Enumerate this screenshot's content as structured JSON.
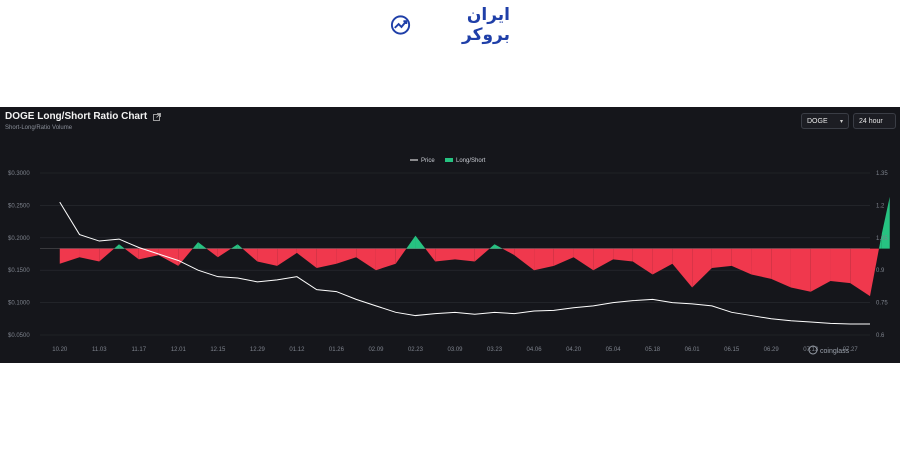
{
  "brand": {
    "text": "ایران بروکر",
    "icon": "chart-trend-icon",
    "color": "#1f3fa8"
  },
  "header": {
    "title": "DOGE Long/Short Ratio Chart",
    "subtitle": "Short-Long/Ratio Volume",
    "coin_select": "DOGE",
    "range_select": "24 hour"
  },
  "colors": {
    "price": "#ffffff",
    "long": "#26c281",
    "short": "#f0384d",
    "background": "#15161b"
  },
  "watermark": "coinglass",
  "chart_data": {
    "type": "area",
    "legend": [
      "Price",
      "Long/Short"
    ],
    "legend_position": "top-center",
    "x_ticks": [
      "10.20",
      "11.03",
      "11.17",
      "12.01",
      "12.15",
      "12.29",
      "01.12",
      "01.26",
      "02.09",
      "02.23",
      "03.09",
      "03.23",
      "04.06",
      "04.20",
      "05.04",
      "05.18",
      "06.01",
      "06.15",
      "06.29",
      "07.13",
      "07.27"
    ],
    "y_left": {
      "ticks": [
        "$0.0500",
        "$0.1000",
        "$0.1500",
        "$0.2000",
        "$0.2500",
        "$0.3000"
      ],
      "range": [
        0.05,
        0.3
      ]
    },
    "y_right": {
      "ticks": [
        "0.6",
        "0.75",
        "0.9",
        "1.05",
        "1.2",
        "1.35"
      ],
      "range": [
        0.6,
        1.35
      ],
      "baseline": 1.0
    },
    "price": {
      "name": "Price",
      "x": [
        0,
        0.5,
        1,
        1.5,
        2,
        2.5,
        3,
        3.5,
        4,
        4.5,
        5,
        5.5,
        6,
        6.5,
        7,
        7.5,
        8,
        8.5,
        9,
        9.5,
        10,
        10.5,
        11,
        11.5,
        12,
        12.5,
        13,
        13.5,
        14,
        14.5,
        15,
        15.5,
        16,
        16.5,
        17,
        17.5,
        18,
        18.5,
        19,
        19.5,
        20,
        20.5
      ],
      "values": [
        0.255,
        0.205,
        0.195,
        0.198,
        0.185,
        0.175,
        0.165,
        0.15,
        0.14,
        0.138,
        0.132,
        0.135,
        0.14,
        0.12,
        0.117,
        0.105,
        0.095,
        0.085,
        0.08,
        0.083,
        0.085,
        0.082,
        0.085,
        0.083,
        0.087,
        0.088,
        0.092,
        0.095,
        0.1,
        0.103,
        0.105,
        0.1,
        0.098,
        0.095,
        0.085,
        0.08,
        0.075,
        0.072,
        0.07,
        0.068,
        0.067,
        0.067
      ]
    },
    "long_short": {
      "name": "Long/Short",
      "x": [
        0,
        0.5,
        1,
        1.5,
        2,
        2.5,
        3,
        3.5,
        4,
        4.5,
        5,
        5.5,
        6,
        6.5,
        7,
        7.5,
        8,
        8.5,
        9,
        9.5,
        10,
        10.5,
        11,
        11.5,
        12,
        12.5,
        13,
        13.5,
        14,
        14.5,
        15,
        15.5,
        16,
        16.5,
        17,
        17.5,
        18,
        18.5,
        19,
        19.5,
        20,
        20.5,
        20.8,
        21
      ],
      "values": [
        0.93,
        0.96,
        0.94,
        1.02,
        0.95,
        0.97,
        0.92,
        1.03,
        0.96,
        1.02,
        0.94,
        0.92,
        0.98,
        0.91,
        0.93,
        0.96,
        0.9,
        0.93,
        1.06,
        0.94,
        0.95,
        0.94,
        1.02,
        0.97,
        0.9,
        0.92,
        0.96,
        0.9,
        0.95,
        0.94,
        0.88,
        0.93,
        0.82,
        0.91,
        0.92,
        0.88,
        0.86,
        0.82,
        0.8,
        0.85,
        0.84,
        0.78,
        1.07,
        1.24
      ]
    }
  }
}
